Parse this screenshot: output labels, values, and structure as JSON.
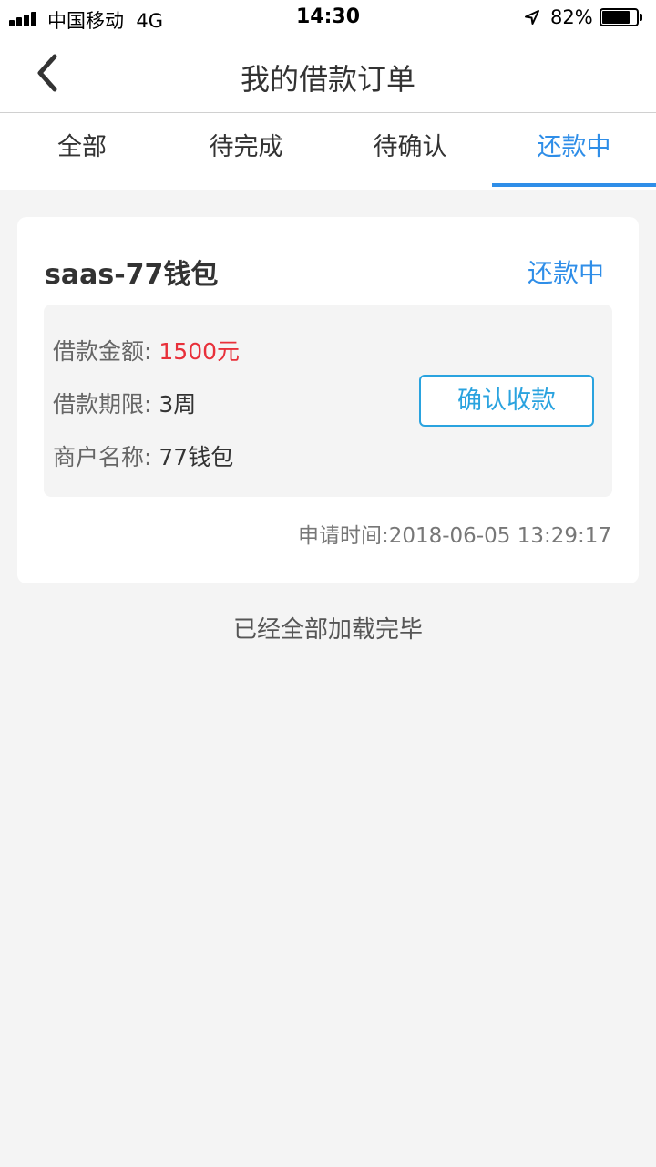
{
  "status_bar": {
    "carrier": "中国移动",
    "network": "4G",
    "time": "14:30",
    "battery_percent": "82%",
    "battery_level": 0.82,
    "icons": [
      "signal-icon",
      "location-arrow-icon",
      "battery-icon"
    ]
  },
  "nav": {
    "title": "我的借款订单",
    "back_icon": "chevron-left-icon"
  },
  "tabs": [
    {
      "label": "全部",
      "active": false
    },
    {
      "label": "待完成",
      "active": false
    },
    {
      "label": "待确认",
      "active": false
    },
    {
      "label": "还款中",
      "active": true
    }
  ],
  "order": {
    "merchant_title": "saas-77钱包",
    "status": "还款中",
    "amount_label": "借款金额:",
    "amount_value": "1500元",
    "term_label": "借款期限:",
    "term_value": "3周",
    "merchant_label": "商户名称:",
    "merchant_value": "77钱包",
    "confirm_button": "确认收款",
    "apply_time": "申请时间:2018-06-05 13:29:17"
  },
  "footer": {
    "load_complete": "已经全部加载完毕"
  },
  "colors": {
    "accent": "#2f8ee8",
    "amount": "#e8303a",
    "button_border": "#2aa3df",
    "background": "#f4f4f4"
  }
}
